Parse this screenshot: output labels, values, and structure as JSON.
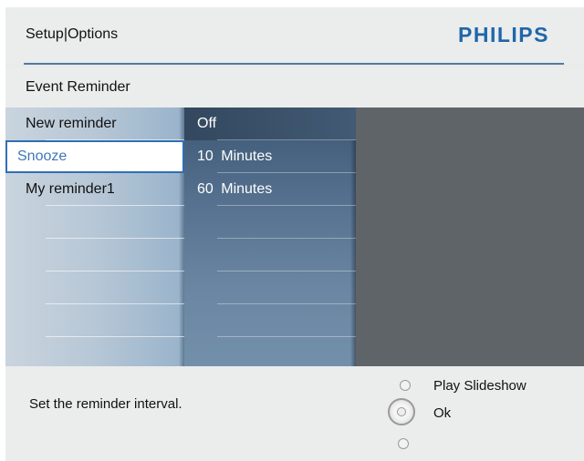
{
  "header": {
    "breadcrumb": "Setup|Options",
    "brand": "PHILIPS"
  },
  "subheader": {
    "title": "Event Reminder"
  },
  "menu": {
    "items": [
      {
        "label": "New reminder"
      },
      {
        "label": "Snooze",
        "selected": true
      },
      {
        "label": "My reminder1"
      },
      {
        "label": ""
      },
      {
        "label": ""
      },
      {
        "label": ""
      },
      {
        "label": ""
      },
      {
        "label": ""
      }
    ]
  },
  "options": {
    "items": [
      {
        "label": "Off",
        "highlighted": true
      },
      {
        "label": "10 Minutes"
      },
      {
        "label": "60 Minutes"
      },
      {
        "label": ""
      },
      {
        "label": ""
      },
      {
        "label": ""
      },
      {
        "label": ""
      },
      {
        "label": ""
      }
    ]
  },
  "footer": {
    "help_text": "Set the reminder interval.",
    "hints": {
      "up": "Play Slideshow",
      "center": "Ok"
    }
  },
  "colors": {
    "brand": "#1f66a9",
    "selection_border": "#2f6fb5",
    "selection_text": "#3f77b8"
  }
}
